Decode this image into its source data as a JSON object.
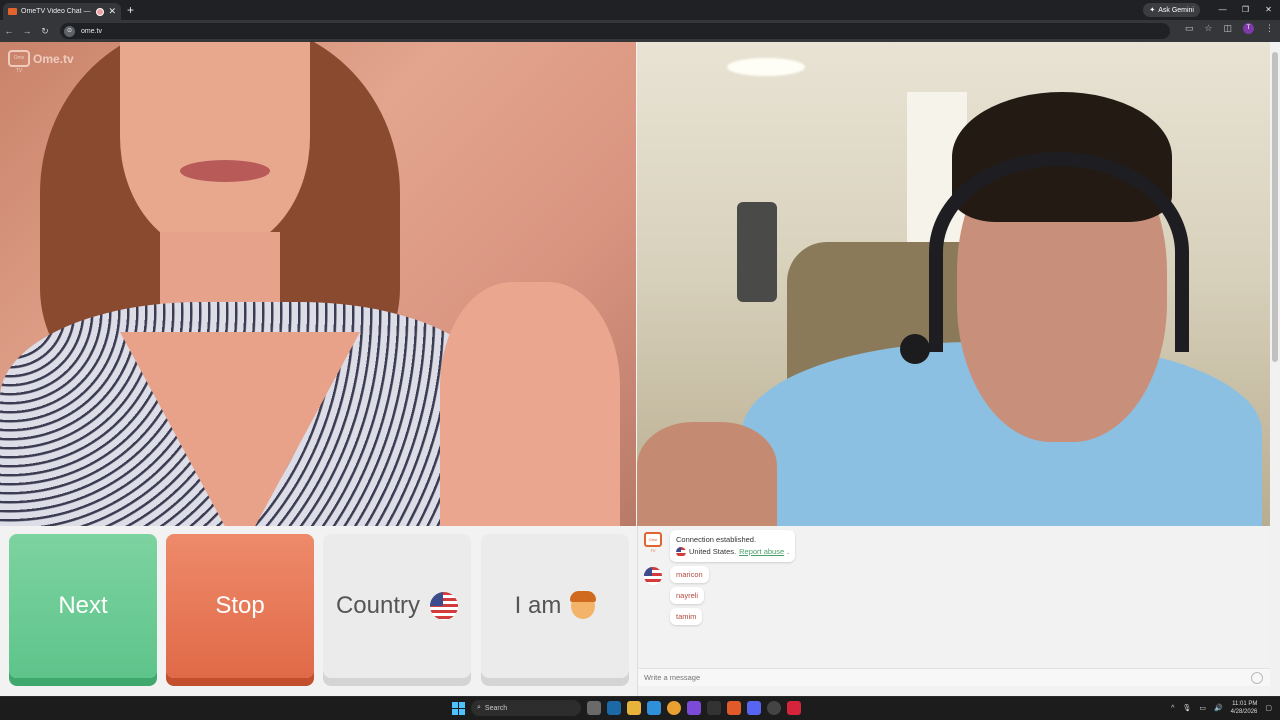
{
  "browser": {
    "tab_title": "OmeTV Video Chat — Ome",
    "new_tab_label": "+",
    "ask_gemini": "Ask Gemini",
    "url": "ome.tv",
    "profile_initial": "T"
  },
  "logo": {
    "tv_text": "Ome TV",
    "name": "Ome.tv"
  },
  "controls": {
    "next_label": "Next",
    "stop_label": "Stop",
    "country_label": "Country",
    "iam_label": "I am"
  },
  "chat": {
    "system_icon_text": "Ome TV",
    "system_line1": "Connection established.",
    "system_country": "United States.",
    "report_label": "Report abuse",
    "system_period": ".",
    "messages": [
      {
        "text": "maricon"
      },
      {
        "text": "nayreli"
      },
      {
        "text": "tamim"
      }
    ],
    "input_placeholder": "Write a message"
  },
  "taskbar": {
    "search_label": "Search",
    "time": "11:01 PM",
    "date": "4/28/2026"
  },
  "colors": {
    "next": "#5ec48a",
    "stop": "#e06a48",
    "brand": "#e0642c",
    "link": "#4aa06a"
  },
  "icons": [
    "back-icon",
    "forward-icon",
    "reload-icon",
    "star-icon",
    "windows-icon",
    "search-icon",
    "us-flag-icon",
    "person-emoji-icon",
    "smile-icon"
  ]
}
